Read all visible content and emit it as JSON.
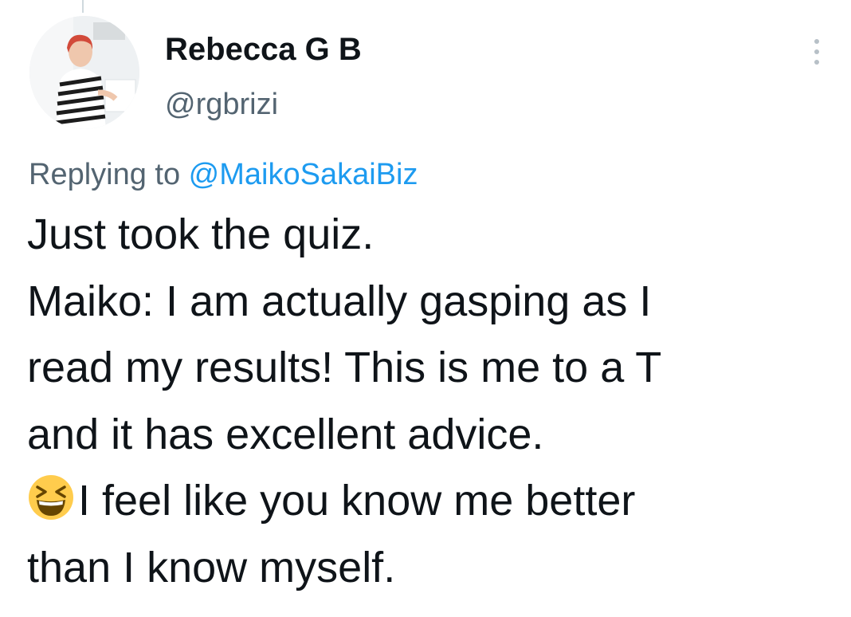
{
  "tweet": {
    "author": {
      "display_name": "Rebecca G B",
      "handle": "@rgbrizi",
      "avatar_icon": "profile-photo"
    },
    "more_icon": "more-vertical-icon",
    "reply": {
      "prefix": "Replying to ",
      "mention": "@MaikoSakaiBiz"
    },
    "lines": [
      "Just took the quiz.",
      "Maiko: I am actually gasping as I",
      "read my results! This is me to a T",
      "and it has excellent advice.",
      "I feel like you know me better",
      "than I know myself."
    ],
    "emoji": {
      "name": "grinning-squinting-face",
      "line_index": 4
    }
  },
  "colors": {
    "text": "#0f1419",
    "secondary": "#536471",
    "link": "#1d9bf0",
    "thread_line": "#cfd9de"
  }
}
